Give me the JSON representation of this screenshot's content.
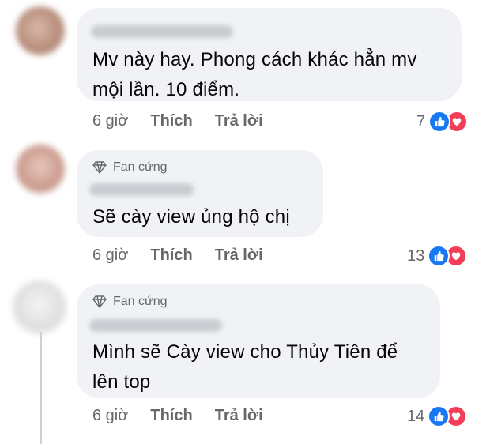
{
  "comments": [
    {
      "badge": "",
      "text_lines": [
        "Mv này hay. Phong cách khác hẳn mv",
        "mội lần. 10 điểm."
      ],
      "time": "6 giờ",
      "like": "Thích",
      "reply": "Trả lời",
      "reaction_count": "7",
      "reactions": [
        "like-icon",
        "love-icon"
      ]
    },
    {
      "badge": "Fan cứng",
      "text_lines": [
        "Sẽ cày view ủng hộ chị"
      ],
      "time": "6 giờ",
      "like": "Thích",
      "reply": "Trả lời",
      "reaction_count": "13",
      "reactions": [
        "like-icon",
        "love-icon"
      ]
    },
    {
      "badge": "Fan cứng",
      "text_lines": [
        "Mình sẽ Cày view cho Thủy Tiên để",
        "lên top"
      ],
      "time": "6 giờ",
      "like": "Thích",
      "reply": "Trả lời",
      "reaction_count": "14",
      "reactions": [
        "like-icon",
        "love-icon"
      ]
    }
  ],
  "colors": {
    "bubble": "#f0f2f5",
    "meta_text": "#65676b",
    "like_blue": "#1877f2",
    "love_red": "#f33e58"
  }
}
